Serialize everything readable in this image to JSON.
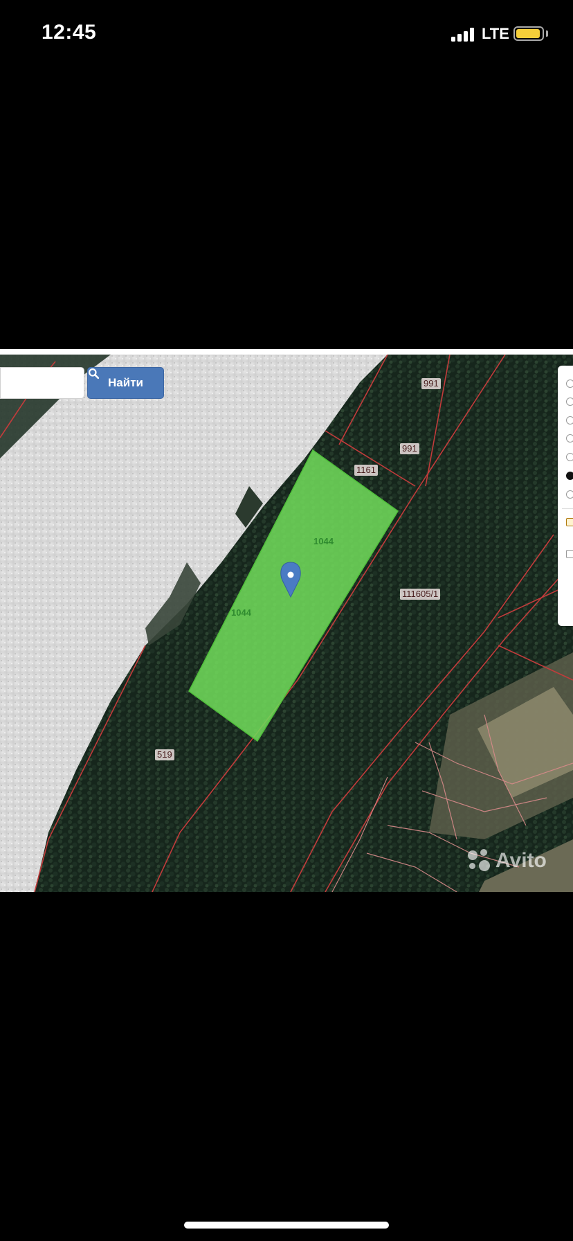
{
  "status_bar": {
    "time": "12:45",
    "network": "LTE",
    "battery_level": 0.8
  },
  "map": {
    "search": {
      "input_value": "",
      "button_label": "Найти",
      "button_icon": "search-icon"
    },
    "plots": [
      {
        "id": "991",
        "label": "991"
      },
      {
        "id": "991b",
        "label": "991"
      },
      {
        "id": "1161",
        "label": "1161"
      },
      {
        "id": "1044a",
        "label": "1044"
      },
      {
        "id": "1044b",
        "label": "1044"
      },
      {
        "id": "111605",
        "label": "111605/1"
      },
      {
        "id": "519",
        "label": "519"
      }
    ],
    "selected_plot_color": "#6fd85a",
    "boundary_color": "#c23b3b",
    "marker_color": "#4a7bc4",
    "layer_panel": {
      "radios": 8,
      "selected_radio_index": 6
    },
    "watermark": "Avito"
  }
}
